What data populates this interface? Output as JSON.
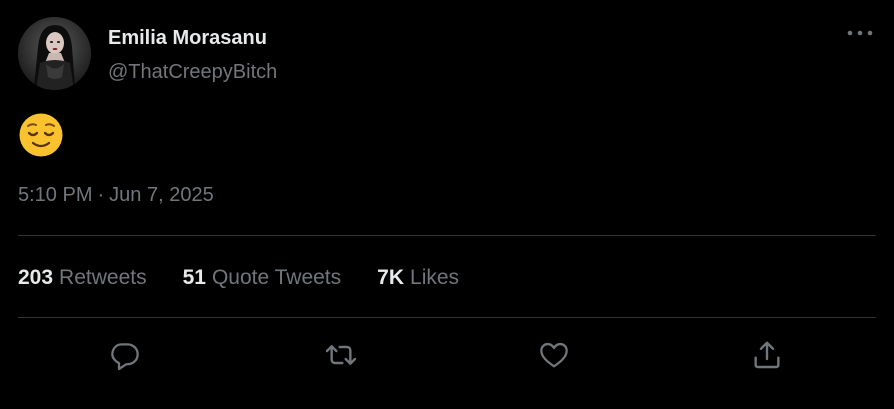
{
  "author": {
    "display_name": "Emilia Morasanu",
    "handle": "@ThatCreepyBitch"
  },
  "tweet": {
    "body_emoji": "relieved-face-emoji",
    "time": "5:10 PM",
    "separator": "·",
    "date": "Jun 7, 2025"
  },
  "stats": [
    {
      "count": "203",
      "label": "Retweets"
    },
    {
      "count": "51",
      "label": "Quote Tweets"
    },
    {
      "count": "7K",
      "label": "Likes"
    }
  ],
  "actions": {
    "reply_icon": "speech-bubble-icon",
    "retweet_icon": "retweet-arrows-icon",
    "like_icon": "heart-icon",
    "share_icon": "upload-share-icon",
    "more_icon": "ellipsis-icon"
  },
  "colors": {
    "background": "#000000",
    "primary_text": "#e7e9ea",
    "secondary_text": "#71767b",
    "divider": "#2f3336",
    "emoji_yellow": "#f9c22e"
  }
}
